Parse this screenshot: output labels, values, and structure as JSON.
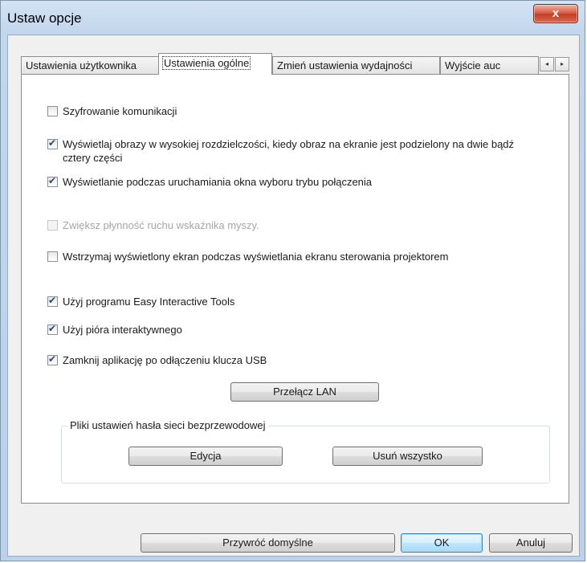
{
  "window": {
    "title": "Ustaw opcje",
    "close_label": "x"
  },
  "tabs": [
    {
      "label": "Ustawienia użytkownika",
      "active": false
    },
    {
      "label": "Ustawienia ogólne",
      "active": true
    },
    {
      "label": "Zmień ustawienia wydajności",
      "active": false
    },
    {
      "label": "Wyjście auc",
      "active": false
    }
  ],
  "tab_scroll": {
    "left": "◂",
    "right": "▸"
  },
  "options": [
    {
      "label": "Szyfrowanie komunikacji",
      "checked": false,
      "enabled": true
    },
    {
      "label": "Wyświetlaj obrazy w wysokiej rozdzielczości, kiedy obraz na ekranie jest podzielony na dwie bądź cztery części",
      "checked": true,
      "enabled": true
    },
    {
      "label": "Wyświetlanie podczas uruchamiania okna wyboru trybu połączenia",
      "checked": true,
      "enabled": true
    },
    {
      "label": "Zwiększ płynność ruchu wskaźnika myszy.",
      "checked": false,
      "enabled": false
    },
    {
      "label": "Wstrzymaj wyświetlony ekran podczas wyświetlania ekranu sterowania projektorem",
      "checked": false,
      "enabled": true
    },
    {
      "label": "Użyj programu Easy Interactive Tools",
      "checked": true,
      "enabled": true
    },
    {
      "label": "Użyj pióra interaktywnego",
      "checked": true,
      "enabled": true
    },
    {
      "label": "Zamknij aplikację po odłączeniu klucza USB",
      "checked": true,
      "enabled": true
    }
  ],
  "switch_lan_label": "Przełącz LAN",
  "wireless_group": {
    "title": "Pliki ustawień hasła sieci bezprzewodowej",
    "edit_label": "Edycja",
    "delete_all_label": "Usuń wszystko"
  },
  "footer": {
    "restore_defaults_label": "Przywróć domyślne",
    "ok_label": "OK",
    "cancel_label": "Anuluj"
  }
}
